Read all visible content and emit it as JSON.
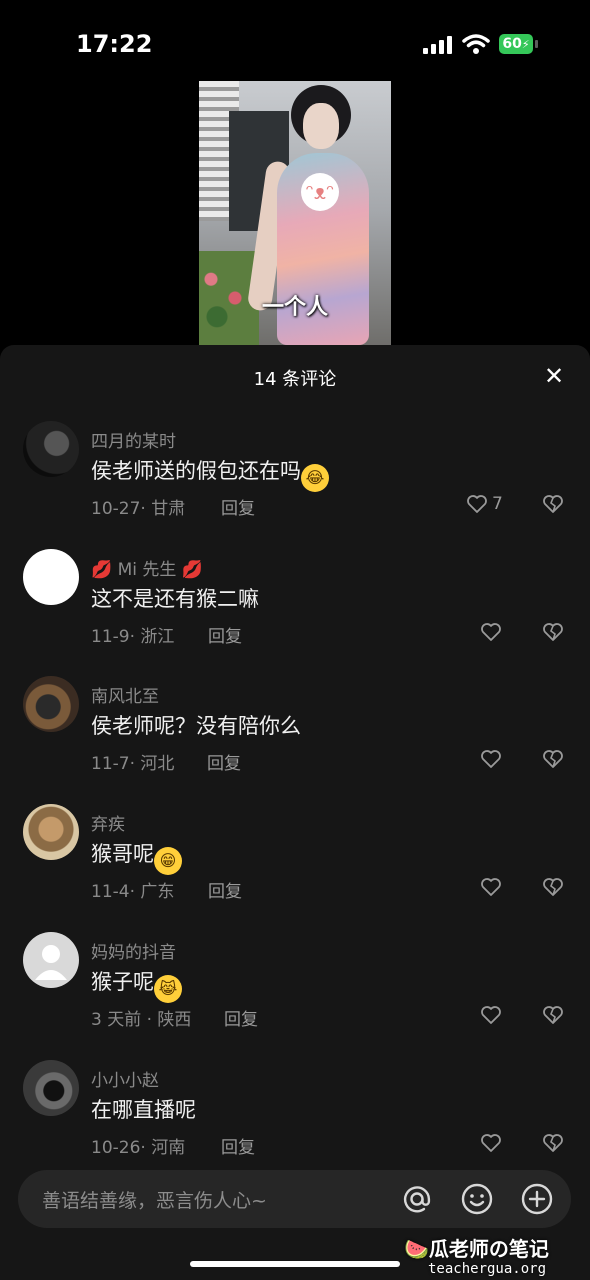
{
  "status_bar": {
    "time": "17:22",
    "battery": "60"
  },
  "video": {
    "caption": "一个人"
  },
  "comments_panel": {
    "title": "14 条评论",
    "comments": [
      {
        "username": "四月的某时",
        "text": "侯老师送的假包还在吗",
        "emoji": "rofl",
        "date_location": "10-27· 甘肃",
        "reply": "回复",
        "likes": "7"
      },
      {
        "username": "💋 Mi 先生 💋",
        "text": "这不是还有猴二嘛",
        "emoji": "",
        "date_location": "11-9· 浙江",
        "reply": "回复",
        "likes": ""
      },
      {
        "username": "南风北至",
        "text": "侯老师呢？没有陪你么",
        "emoji": "",
        "date_location": "11-7· 河北",
        "reply": "回复",
        "likes": ""
      },
      {
        "username": "弃疾",
        "text": "猴哥呢",
        "emoji": "grin",
        "date_location": "11-4· 广东",
        "reply": "回复",
        "likes": ""
      },
      {
        "username": "妈妈的抖音",
        "text": "猴子呢",
        "emoji": "joy",
        "date_location": "3 天前 · 陕西",
        "reply": "回复",
        "likes": ""
      },
      {
        "username": "小小小赵",
        "text": "在哪直播呢",
        "emoji": "",
        "date_location": "10-26· 河南",
        "reply": "回复",
        "likes": ""
      }
    ]
  },
  "input_bar": {
    "placeholder": "善语结善缘，恶言伤人心~"
  },
  "watermark": {
    "title": "瓜老师の笔记",
    "url": "teachergua.org"
  },
  "colors": {
    "panel_bg": "#161616",
    "text_secondary": "#8a8a8a",
    "battery_green": "#35c759",
    "input_bg": "#262626"
  },
  "icons": [
    "signal-icon",
    "wifi-icon",
    "battery-icon",
    "close-icon",
    "heart-icon",
    "broken-heart-icon",
    "at-icon",
    "emoji-icon",
    "plus-icon",
    "watermelon-icon"
  ]
}
